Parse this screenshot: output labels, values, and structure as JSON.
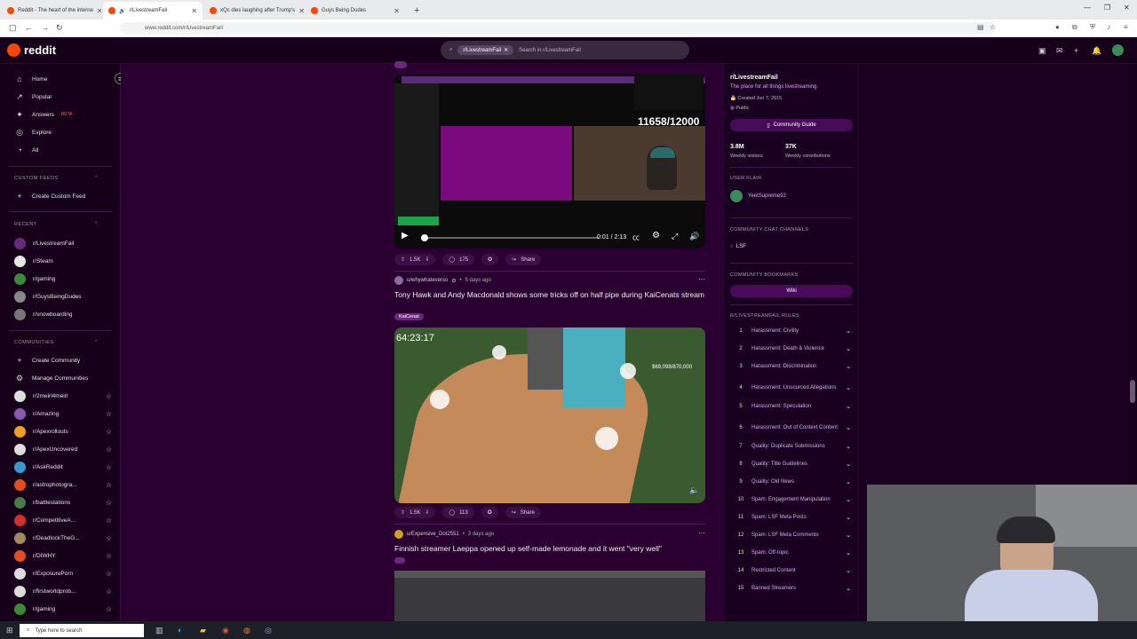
{
  "browser": {
    "tabs": [
      {
        "label": "Reddit - The heart of the interne",
        "active": false
      },
      {
        "label": "r/LivestreamFail",
        "active": true
      },
      {
        "label": "xQc dies laughing after Trump's",
        "active": false
      },
      {
        "label": "Guys Being Dudes",
        "active": false
      }
    ],
    "url": "www.reddit.com/r/LivestreamFail/"
  },
  "header": {
    "logo": "reddit",
    "search_chip": "r/LivestreamFail",
    "search_placeholder": "Search in r/LivestreamFail"
  },
  "left_sidebar": {
    "nav": [
      {
        "label": "Home",
        "icon": "home-icon"
      },
      {
        "label": "Popular",
        "icon": "popular-icon"
      },
      {
        "label": "Answers",
        "icon": "answers-icon",
        "badge": "BETA"
      },
      {
        "label": "Explore",
        "icon": "explore-icon"
      },
      {
        "label": "All",
        "icon": "all-icon"
      }
    ],
    "custom_feeds_heading": "CUSTOM FEEDS",
    "create_custom_feed": "Create Custom Feed",
    "recent_heading": "RECENT",
    "recent": [
      {
        "label": "r/LivestreamFail",
        "color": "#6a2a7c"
      },
      {
        "label": "r/Steam",
        "color": "#e8e8e8"
      },
      {
        "label": "r/gaming",
        "color": "#3a8a3a"
      },
      {
        "label": "r/GuysBeingDudes",
        "color": "#888888"
      },
      {
        "label": "r/snowboarding",
        "color": "#777777"
      }
    ],
    "communities_heading": "COMMUNITIES",
    "create_community": "Create Community",
    "manage_communities": "Manage Communities",
    "communities": [
      {
        "label": "r/2meirl4meirl",
        "color": "#dddddd"
      },
      {
        "label": "r/Amazing",
        "color": "#8a5ab0"
      },
      {
        "label": "r/Apexrollouts",
        "color": "#f0a020"
      },
      {
        "label": "r/ApexUncovered",
        "color": "#dddddd"
      },
      {
        "label": "r/AskReddit",
        "color": "#3a9ad0"
      },
      {
        "label": "r/astrophotogra...",
        "color": "#e05020"
      },
      {
        "label": "r/battlestations",
        "color": "#4a7a4a"
      },
      {
        "label": "r/CompetitiveA...",
        "color": "#d03030"
      },
      {
        "label": "r/DeadlockTheG...",
        "color": "#a08a60"
      },
      {
        "label": "r/DIWHY",
        "color": "#e05020"
      },
      {
        "label": "r/ExposurePorn",
        "color": "#dddddd"
      },
      {
        "label": "r/firstworldprob...",
        "color": "#dddddd"
      },
      {
        "label": "r/gaming",
        "color": "#3a8a3a"
      }
    ]
  },
  "feed": {
    "post1": {
      "views": "11658/12000",
      "time": "0:01 / 2:13",
      "progress": 0.01,
      "upvotes": "1.5K",
      "comments": "175",
      "share": "Share"
    },
    "post2": {
      "author": "u/whywhateverso",
      "age": "5 days ago",
      "title": "Tony Hawk and Andy Macdonald shows some tricks off on half pipe during KaiCenats stream",
      "flair": "KaiCenat",
      "timer": "64:23:17",
      "counter": "$69,098/870,000",
      "upvotes": "1.5K",
      "comments": "113",
      "share": "Share"
    },
    "post3": {
      "author": "u/Expensive_Dot2551",
      "age": "3 days ago",
      "title": "Finnish streamer Laeppa opened up self-made lemonade and it went \"very well\""
    }
  },
  "right_sidebar": {
    "name": "r/LivestreamFail",
    "description": "The place for all things livestreaming.",
    "created": "Created Jun 7, 2015",
    "visibility": "Public",
    "guide_button": "Community Guide",
    "weekly_visitors": "3.8M",
    "weekly_visitors_label": "Weekly visitors",
    "weekly_contributions": "37K",
    "weekly_contributions_label": "Weekly contributions",
    "user_flair_heading": "USER FLAIR",
    "user_flair": "YeetSupreme92",
    "chat_heading": "COMMUNITY CHAT CHANNELS",
    "chat_channel": "LSF",
    "bookmarks_heading": "COMMUNITY BOOKMARKS",
    "wiki_button": "Wiki",
    "rules_heading": "R/LIVESTREAMFAIL RULES",
    "rules": [
      {
        "n": "1",
        "text": "Harassment: Civility"
      },
      {
        "n": "2",
        "text": "Harassment: Death & Violence"
      },
      {
        "n": "3",
        "text": "Harassment: Discrimination"
      },
      {
        "n": "4",
        "text": "Harassment: Unsourced Allegations"
      },
      {
        "n": "5",
        "text": "Harassment: Speculation"
      },
      {
        "n": "6",
        "text": "Harassment: Out of Context Content"
      },
      {
        "n": "7",
        "text": "Quality: Duplicate Submissions"
      },
      {
        "n": "8",
        "text": "Quality: Title Guidelines"
      },
      {
        "n": "9",
        "text": "Quality: Old News"
      },
      {
        "n": "10",
        "text": "Spam: Engagement Manipulation"
      },
      {
        "n": "11",
        "text": "Spam: LSF Meta Posts"
      },
      {
        "n": "12",
        "text": "Spam: LSF Meta Comments"
      },
      {
        "n": "13",
        "text": "Spam: Off-topic"
      },
      {
        "n": "14",
        "text": "Restricted Content"
      },
      {
        "n": "15",
        "text": "Banned Streamers"
      }
    ]
  },
  "taskbar": {
    "search_placeholder": "Type here to search"
  }
}
